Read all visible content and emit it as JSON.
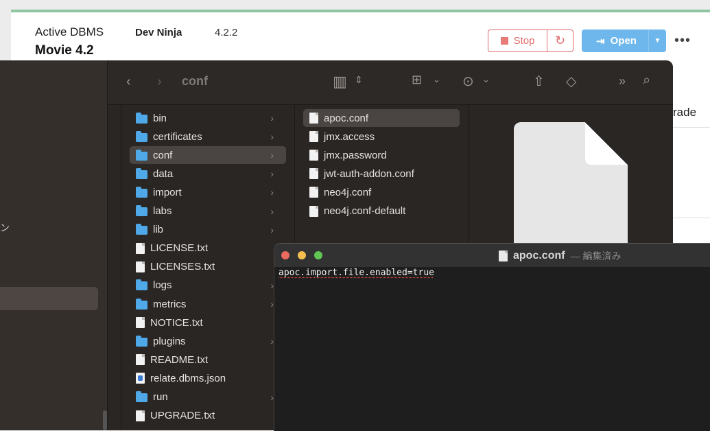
{
  "neo4j": {
    "active_label": "Active DBMS",
    "dbms_name": "Movie 4.2",
    "project": "Dev Ninja",
    "version": "4.2.2",
    "stop_label": "Stop",
    "open_label": "Open",
    "more_label": "•••",
    "partial_upgrade": "rade",
    "colors": {
      "stop": "#e06a6a",
      "open": "#6db7ec",
      "accent_bar": "#8fc5a0"
    }
  },
  "finder": {
    "path_title": "conf",
    "sidebar_partial_char": "ン",
    "column1": [
      {
        "label": "bin",
        "kind": "folder"
      },
      {
        "label": "certificates",
        "kind": "folder"
      },
      {
        "label": "conf",
        "kind": "folder",
        "selected": true
      },
      {
        "label": "data",
        "kind": "folder"
      },
      {
        "label": "import",
        "kind": "folder"
      },
      {
        "label": "labs",
        "kind": "folder"
      },
      {
        "label": "lib",
        "kind": "folder"
      },
      {
        "label": "LICENSE.txt",
        "kind": "file"
      },
      {
        "label": "LICENSES.txt",
        "kind": "file"
      },
      {
        "label": "logs",
        "kind": "folder"
      },
      {
        "label": "metrics",
        "kind": "folder"
      },
      {
        "label": "NOTICE.txt",
        "kind": "file"
      },
      {
        "label": "plugins",
        "kind": "folder"
      },
      {
        "label": "README.txt",
        "kind": "file"
      },
      {
        "label": "relate.dbms.json",
        "kind": "json"
      },
      {
        "label": "run",
        "kind": "folder"
      },
      {
        "label": "UPGRADE.txt",
        "kind": "file"
      }
    ],
    "column2": [
      {
        "label": "apoc.conf",
        "selected": true
      },
      {
        "label": "jmx.access"
      },
      {
        "label": "jmx.password"
      },
      {
        "label": "jwt-auth-addon.conf"
      },
      {
        "label": "neo4j.conf"
      },
      {
        "label": "neo4j.conf-default"
      }
    ]
  },
  "editor": {
    "filename": "apoc.conf",
    "status": "— 編集済み",
    "content": "apoc.import.file.enabled=true"
  }
}
